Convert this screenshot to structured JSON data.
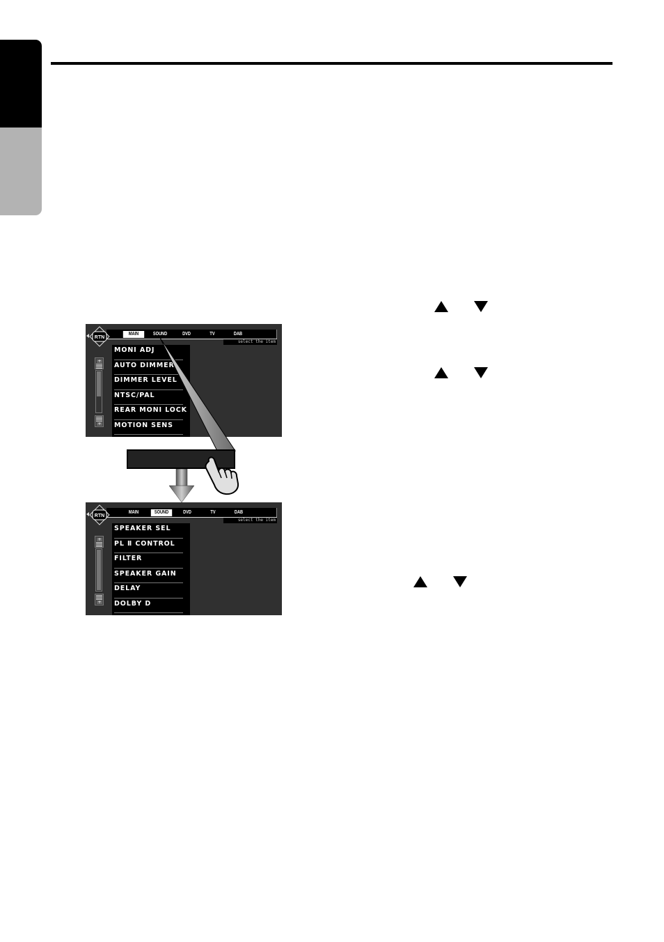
{
  "page": {
    "side_tab_colors": {
      "top": "#000000",
      "bottom": "#b3b3b3"
    }
  },
  "screen_main": {
    "rtn_label": "RTN",
    "tabs": [
      {
        "label": "MAIN",
        "active": true
      },
      {
        "label": "SOUND",
        "active": false
      },
      {
        "label": "DVD",
        "active": false
      },
      {
        "label": "TV",
        "active": false
      },
      {
        "label": "DAB",
        "active": false
      }
    ],
    "hint": "select the item",
    "items": [
      "MONI ADJ",
      "AUTO DIMMER",
      "DIMMER LEVEL",
      "NTSC/PAL",
      "REAR MONI LOCK",
      "MOTION SENS"
    ],
    "scroll_up_label": "+",
    "scroll_down_label": "+"
  },
  "screen_sound": {
    "rtn_label": "RTN",
    "tabs": [
      {
        "label": "MAIN",
        "active": false
      },
      {
        "label": "SOUND",
        "active": true
      },
      {
        "label": "DVD",
        "active": false
      },
      {
        "label": "TV",
        "active": false
      },
      {
        "label": "DAB",
        "active": false
      }
    ],
    "hint": "select the item",
    "items": [
      "SPEAKER SEL",
      "PL Ⅱ CONTROL",
      "FILTER",
      "SPEAKER GAIN",
      "DELAY",
      "DOLBY D"
    ],
    "scroll_up_label": "+",
    "scroll_down_label": "+"
  },
  "icons": {
    "step_arrows": [
      "up-triangle",
      "down-triangle"
    ],
    "pointer": "hand-pointer",
    "transition": "down-arrow"
  }
}
